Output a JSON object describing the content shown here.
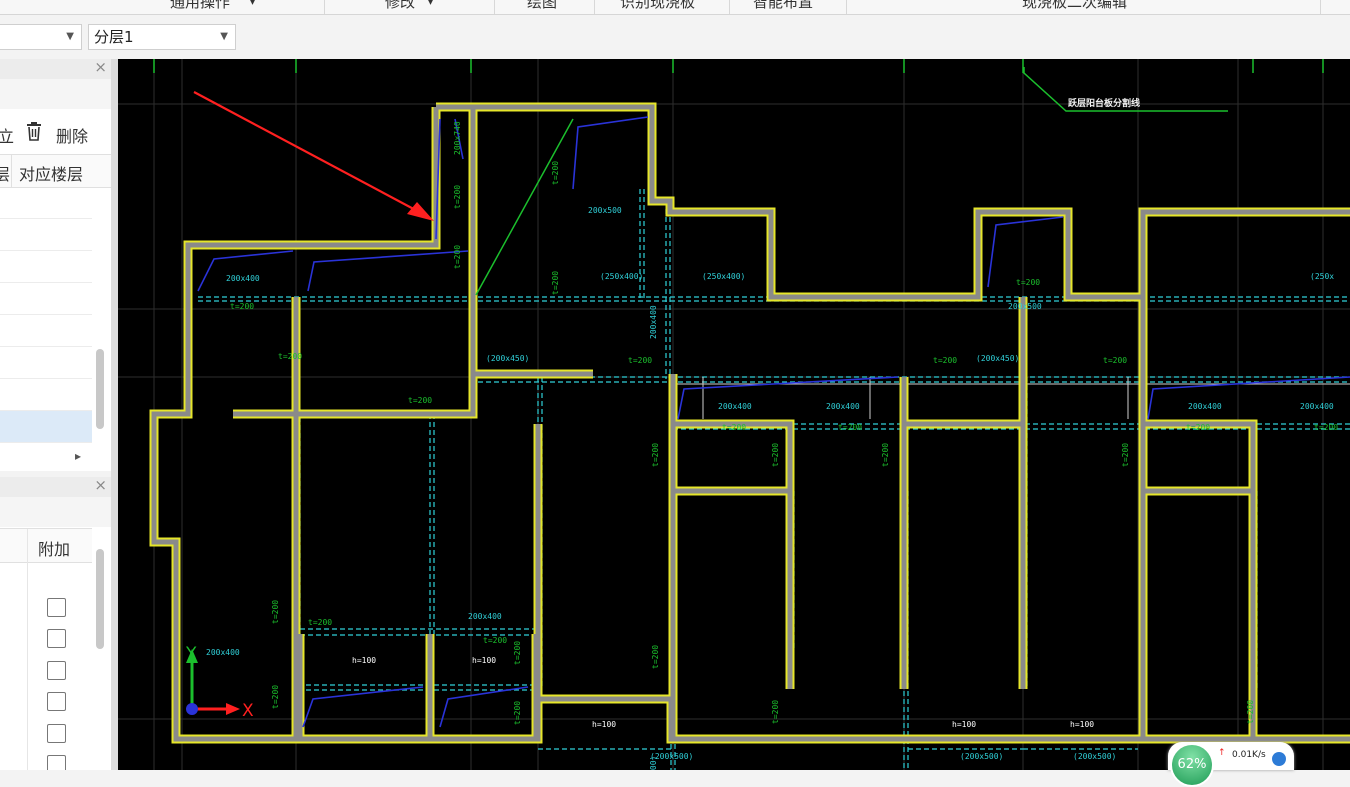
{
  "ribbon": {
    "tabs": [
      "通用操作",
      "修改",
      "绘图",
      "识别现浇板",
      "智能布置",
      "现浇板二次编辑"
    ]
  },
  "toolbar": {
    "combo1": "",
    "combo2": "分层1"
  },
  "panel_top": {
    "close": "×",
    "delete_label": "删除",
    "cut_text": "立",
    "col_header_cut": "层",
    "col_header": "对应楼层",
    "expand_arrow": "▸"
  },
  "panel_bottom": {
    "close": "×",
    "col_header": "附加",
    "checkboxes": [
      false,
      false,
      false,
      false,
      false,
      false
    ]
  },
  "cad": {
    "label_top_right": "跃层阳台板分割线",
    "wall_labels": [
      "200x740",
      "t=200",
      "t=200",
      "t=200",
      "t=200",
      "t=200",
      "t=200",
      "t=200",
      "t=200",
      "t=200",
      "t=200",
      "t=200",
      "t=200",
      "t=200",
      "t=200",
      "t=200",
      "t=200",
      "t=200",
      "t=200",
      "t=200",
      "t=200",
      "t=200",
      "t=200",
      "t=200",
      "t=200",
      "t=200",
      "t=200",
      "t=200",
      "t=200"
    ],
    "beam_labels": [
      "200x400",
      "200x500",
      "(250x400)",
      "(250x400)",
      "200x500",
      "(250x",
      "(200x450)",
      "(200x450)",
      "200x400",
      "200x400",
      "200x400",
      "200x400",
      "200x400",
      "200x400",
      "200x400",
      "(200x500)",
      "(200x500)",
      "(200x500)",
      "(200x500)"
    ],
    "slab_labels": [
      "h=100",
      "h=100",
      "h=100",
      "h=100",
      "h=100"
    ],
    "axis_x": "X",
    "axis_y": "Y"
  },
  "net": {
    "percent": "62%",
    "speed": "0.01K/s"
  }
}
